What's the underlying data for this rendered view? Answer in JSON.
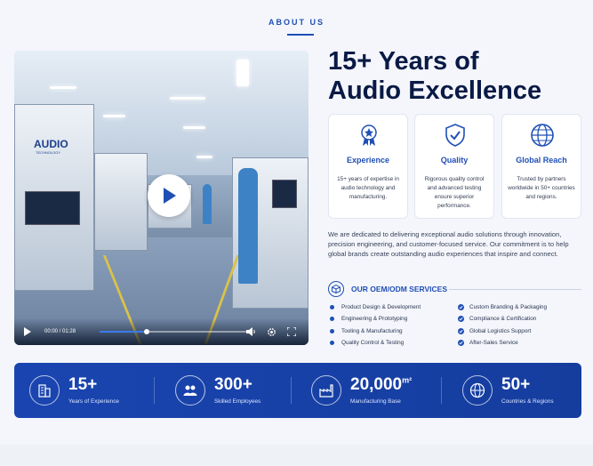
{
  "section": {
    "eyebrow": "ABOUT US"
  },
  "video": {
    "machine_label": "AUDIO",
    "machine_sublabel": "TECHNOLOGY",
    "time": "00:00 / 01:28",
    "progress": 0.31
  },
  "headline": {
    "line1": "15+ Years of",
    "line2": "Audio Excellence"
  },
  "features": [
    {
      "icon": "award-ribbon-icon",
      "title": "Experience",
      "desc": "15+ years of expertise in audio technology and manufacturing."
    },
    {
      "icon": "shield-check-icon",
      "title": "Quality",
      "desc": "Rigorous quality control and advanced testing ensure superior performance."
    },
    {
      "icon": "globe-icon",
      "title": "Global Reach",
      "desc": "Trusted by partners worldwide in 50+ countries and regions."
    }
  ],
  "intro": "We are dedicated to delivering exceptional audio solutions through innovation, precision engineering, and customer-focused service. Our commitment is to help global brands create outstanding audio experiences that inspire and connect.",
  "services": {
    "title": "OUR OEM/ODM SERVICES",
    "left": [
      "Product Design & Development",
      "Engineering & Prototyping",
      "Tooling & Manufacturing",
      "Quality Control & Testing"
    ],
    "right": [
      "Custom Branding & Packaging",
      "Compliance & Certification",
      "Global Logistics Support",
      "After-Sales Service"
    ]
  },
  "stats": [
    {
      "icon": "building-icon",
      "value": "15+",
      "unit": "",
      "label": "Years of Experience"
    },
    {
      "icon": "team-icon",
      "value": "300+",
      "unit": "",
      "label": "Skilled Employees"
    },
    {
      "icon": "factory-icon",
      "value": "20,000",
      "unit": "m²",
      "label": "Manufacturing Base"
    },
    {
      "icon": "globe-icon",
      "value": "50+",
      "unit": "",
      "label": "Countries & Regions"
    }
  ],
  "colors": {
    "accent": "#1f4fb5",
    "heading": "#0a1a45",
    "banner": "#1a45b0"
  }
}
